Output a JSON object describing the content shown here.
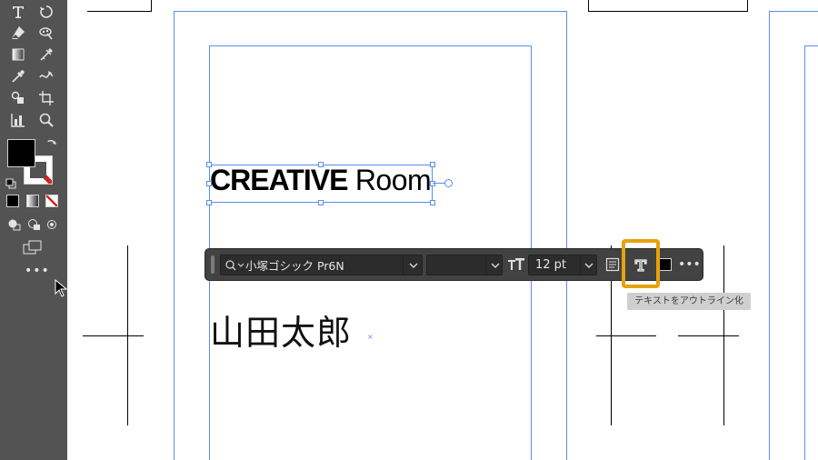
{
  "toolbar": {
    "tools": [
      {
        "name": "type-tool-icon"
      },
      {
        "name": "rotate-tool-icon"
      },
      {
        "name": "eraser-tool-icon"
      },
      {
        "name": "puppet-warp-tool-icon"
      },
      {
        "name": "gradient-tool-icon"
      },
      {
        "name": "mesh-tool-icon"
      },
      {
        "name": "eyedropper-tool-icon"
      },
      {
        "name": "blend-tool-icon"
      },
      {
        "name": "shape-builder-tool-icon"
      },
      {
        "name": "artboard-tool-icon"
      },
      {
        "name": "graph-tool-icon"
      },
      {
        "name": "zoom-tool-icon"
      }
    ],
    "fill_color": "#000000",
    "stroke_color": "none",
    "more_tools_label": "•••"
  },
  "canvas": {
    "headline_bold": "CREATIVE",
    "headline_light": "Room",
    "name_text": "山田太郎",
    "guide_color": "#5b8cf0"
  },
  "taskbar": {
    "font_family": "小塚ゴシック Pr6N",
    "font_style": "",
    "font_size": "12 pt",
    "fill_swatch": "#000000",
    "more_label": "•••",
    "tooltip": "テキストをアウトライン化",
    "highlight_color": "#e6a20c"
  }
}
